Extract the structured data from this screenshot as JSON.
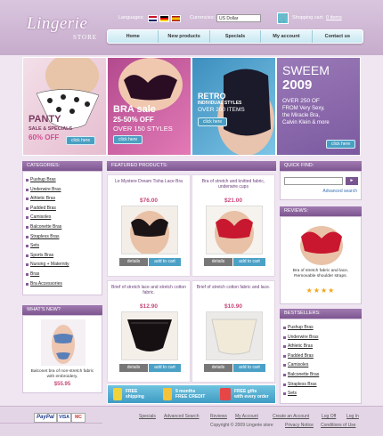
{
  "header": {
    "logo": "Lingerie",
    "logo_sub": "STORE",
    "languages_label": "Languages:",
    "currencies_label": "Currencies:",
    "currency_value": "US Dollar",
    "cart_label": "Shopping cart:",
    "cart_value": "0 items"
  },
  "nav": [
    "Home",
    "New products",
    "Specials",
    "My account",
    "Contact us"
  ],
  "banners": {
    "b1": {
      "line1": "PANTY",
      "line2": "SALE & SPECIALS",
      "line3": "60% OFF",
      "btn": "click here"
    },
    "b2": {
      "line1": "BRA sale",
      "line2": "25-50% OFF",
      "line3": "OVER 150 STYLES",
      "btn": "click here"
    },
    "b3": {
      "line1": "RETRO",
      "line2": "INDIVIDUAL STYLES",
      "line3": "OVER 200 ITEMS",
      "btn": "click here"
    },
    "b4": {
      "line1": "SWEEM",
      "line2": "2009",
      "line3": "OVER 250 OF",
      "line4": "FROM Very Sexy,",
      "line5": "the Miracle Bra,",
      "line6": "Calvin Klein & more",
      "btn": "click here"
    }
  },
  "categories": {
    "title": "CATEGORIES:",
    "items": [
      "Pushup Bras",
      "Underwire Bras",
      "Athletic Bras",
      "Padded Bras",
      "Camisoles",
      "Balconette Bras",
      "Strapless Bras",
      "Sets",
      "Sports Bras",
      "Nursing + Maternity",
      "Bras",
      "Bra Accessories"
    ]
  },
  "whats_new": {
    "title": "WHAT'S NEW?",
    "desc": "Balconet bra of non-stretch fabric with embroidery.",
    "price": "$55.95"
  },
  "featured": {
    "title": "FEATURED PRODUCTS:",
    "products": [
      {
        "title": "Le Mystere Dream Tisha Lace Bra",
        "price": "$76.00",
        "details": "details",
        "cart": "add to cart"
      },
      {
        "title": "Bra of stretch and knitted fabric, underwire cups",
        "price": "$21.00",
        "details": "details",
        "cart": "add to cart"
      },
      {
        "title": "Brief of stretch lace and stretch cotton fabric.",
        "price": "$12.90",
        "details": "details",
        "cart": "add to cart"
      },
      {
        "title": "Brief of stretch cotton fabric and lace.",
        "price": "$10.90",
        "details": "details",
        "cart": "add to cart"
      }
    ]
  },
  "promo": {
    "p1a": "FREE",
    "p1b": "shipping",
    "p2a": "9 months",
    "p2b": "FREE CREDIT",
    "p3a": "FREE gifts",
    "p3b": "with every order"
  },
  "quick_find": {
    "title": "QUICK FIND:",
    "advanced": "Advanced search"
  },
  "reviews": {
    "title": "REVIEWS:",
    "text": "Bra of stretch fabric and lace, Removable shoulder straps.",
    "stars": 4
  },
  "bestsellers": {
    "title": "BESTSELLERS:",
    "items": [
      "Pushup Bras",
      "Underwire Bras",
      "Athletic Bras",
      "Padded Bras",
      "Camisoles",
      "Balconette Bras",
      "Strapless Bras",
      "Sets"
    ]
  },
  "footer": {
    "links": [
      "Specials",
      "Advanced Search",
      "Reviews",
      "My Account",
      "Create an Account",
      "Log Off",
      "Log In"
    ],
    "copyright": "Copyright © 2009 Lingerie store",
    "privacy": "Privacy Notice",
    "conditions": "Conditions of Use",
    "pay": [
      "PayPal",
      "VISA",
      "MC"
    ]
  },
  "colors": {
    "accent": "#8b5b9c",
    "blue": "#4ba0c6",
    "price": "#c9477a"
  }
}
